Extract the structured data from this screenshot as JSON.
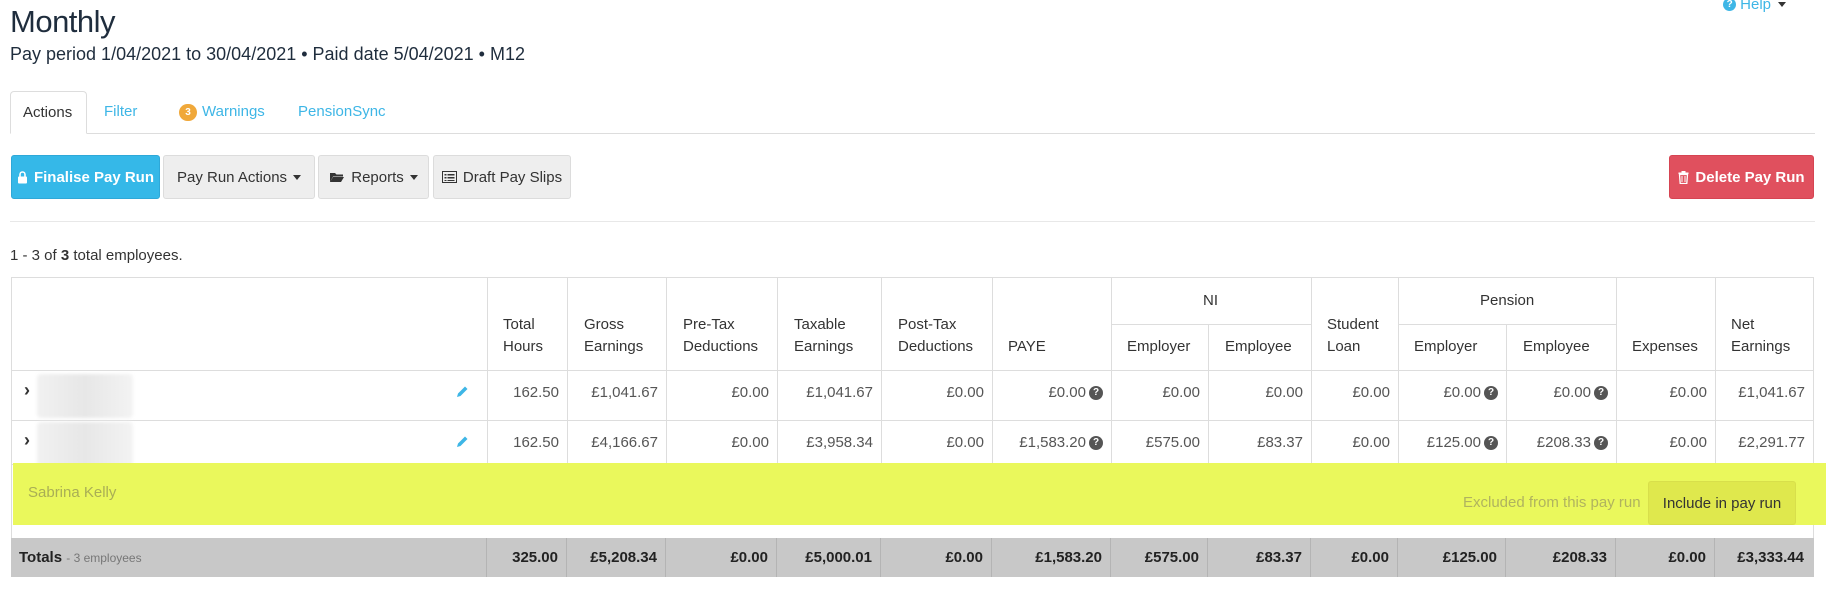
{
  "page": {
    "title": "Monthly",
    "subtitle": "Pay period 1/04/2021 to 30/04/2021 • Paid date 5/04/2021 • M12",
    "help_label": "Help"
  },
  "tabs": [
    {
      "label": "Actions",
      "active": true
    },
    {
      "label": "Filter"
    },
    {
      "label": "Warnings",
      "badge": "3"
    },
    {
      "label": "PensionSync"
    }
  ],
  "toolbar": {
    "finalise": "Finalise Pay Run",
    "actions": "Pay Run Actions",
    "reports": "Reports",
    "draft": "Draft Pay Slips",
    "delete": "Delete Pay Run"
  },
  "summary": {
    "prefix": "1 - 3 of",
    "total": "3",
    "suffix": "total employees."
  },
  "table": {
    "headers": {
      "total_hours": [
        "Total",
        "Hours"
      ],
      "gross": [
        "Gross",
        "Earnings"
      ],
      "pretax": [
        "Pre-Tax",
        "Deductions"
      ],
      "taxable": [
        "Taxable",
        "Earnings"
      ],
      "posttax": [
        "Post-Tax",
        "Deductions"
      ],
      "paye": "PAYE",
      "ni": "NI",
      "ni_employer": "Employer",
      "ni_employee": "Employee",
      "student": [
        "Student",
        "Loan"
      ],
      "pension": "Pension",
      "pen_employer": "Employer",
      "pen_employee": "Employee",
      "expenses": "Expenses",
      "net": [
        "Net",
        "Earnings"
      ]
    },
    "rows": [
      {
        "hours": "162.50",
        "gross": "£1,041.67",
        "pretax": "£0.00",
        "taxable": "£1,041.67",
        "posttax": "£0.00",
        "paye": "£0.00",
        "ni_er": "£0.00",
        "ni_ee": "£0.00",
        "student": "£0.00",
        "pen_er": "£0.00",
        "pen_ee": "£0.00",
        "expenses": "£0.00",
        "net": "£1,041.67"
      },
      {
        "hours": "162.50",
        "gross": "£4,166.67",
        "pretax": "£0.00",
        "taxable": "£3,958.34",
        "posttax": "£0.00",
        "paye": "£1,583.20",
        "ni_er": "£575.00",
        "ni_ee": "£83.37",
        "student": "£0.00",
        "pen_er": "£125.00",
        "pen_ee": "£208.33",
        "expenses": "£0.00",
        "net": "£2,291.77"
      }
    ],
    "excluded": {
      "name": "Sabrina Kelly",
      "note": "Excluded from this pay run",
      "button": "Include in pay run"
    },
    "totals": {
      "label": "Totals",
      "sub": "- 3 employees",
      "hours": "325.00",
      "gross": "£5,208.34",
      "pretax": "£0.00",
      "taxable": "£5,000.01",
      "posttax": "£0.00",
      "paye": "£1,583.20",
      "ni_er": "£575.00",
      "ni_ee": "£83.37",
      "student": "£0.00",
      "pen_er": "£125.00",
      "pen_ee": "£208.33",
      "expenses": "£0.00",
      "net": "£3,333.44"
    }
  },
  "colors": {
    "accent": "#35b8e8",
    "danger": "#e0505e",
    "highlight": "#eaf85c",
    "badge": "#f0a83a"
  }
}
